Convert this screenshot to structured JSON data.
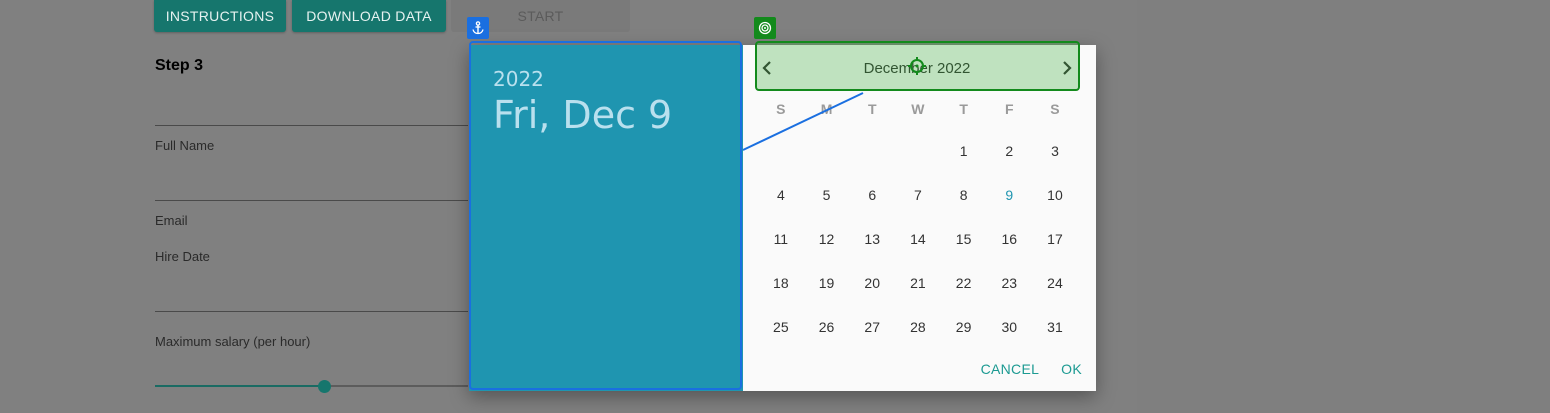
{
  "toolbar": {
    "instructions_label": "INSTRUCTIONS",
    "download_label": "DOWNLOAD DATA",
    "start_label": "START"
  },
  "form": {
    "step_title": "Step 3",
    "full_name_label": "Full Name",
    "email_label": "Email",
    "hire_date_label": "Hire Date",
    "salary_label": "Maximum salary (per hour)",
    "salary_slider_fraction": 0.54
  },
  "date_picker": {
    "year": "2022",
    "selected_date": "Fri, Dec 9",
    "month_label": "December 2022",
    "weekdays": [
      "S",
      "M",
      "T",
      "W",
      "T",
      "F",
      "S"
    ],
    "weeks": [
      [
        "",
        "",
        "",
        "",
        "1",
        "2",
        "3"
      ],
      [
        "4",
        "5",
        "6",
        "7",
        "8",
        "9",
        "10"
      ],
      [
        "11",
        "12",
        "13",
        "14",
        "15",
        "16",
        "17"
      ],
      [
        "18",
        "19",
        "20",
        "21",
        "22",
        "23",
        "24"
      ],
      [
        "25",
        "26",
        "27",
        "28",
        "29",
        "30",
        "31"
      ]
    ],
    "selected_day": "9",
    "cancel_label": "CANCEL",
    "ok_label": "OK",
    "colors": {
      "header": "#1f95b0",
      "accent": "#1c9a92"
    }
  },
  "annotations": {
    "blue_icon": "anchor-icon",
    "green_icon": "target-icon",
    "blue_color": "#1a6fe0",
    "green_color": "#138a1c"
  }
}
